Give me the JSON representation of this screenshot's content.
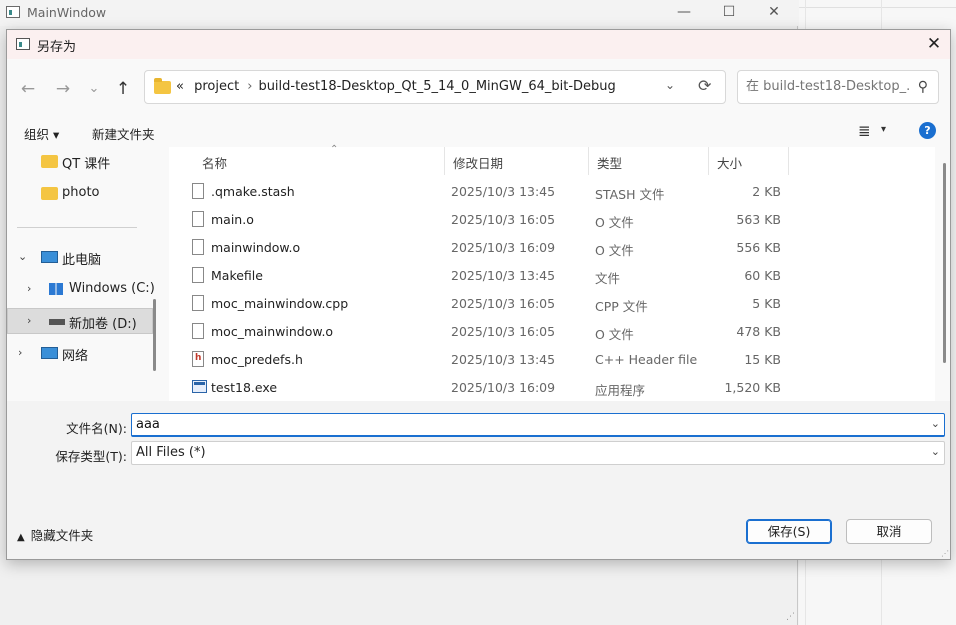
{
  "main_window": {
    "title": "MainWindow",
    "minimize": "—",
    "maximize": "☐",
    "close": "✕"
  },
  "dialog": {
    "title": "另存为",
    "close": "✕",
    "nav": {
      "back": "←",
      "forward": "→",
      "recent": "⌄",
      "up": "↑"
    },
    "address": {
      "overflow": "«",
      "path": [
        "project",
        "build-test18-Desktop_Qt_5_14_0_MinGW_64_bit-Debug"
      ],
      "separator": "›",
      "dropdown": "⌄",
      "refresh": "⟳"
    },
    "search": {
      "placeholder": "在 build-test18-Desktop_...",
      "icon": "search-icon"
    },
    "toolbar": {
      "organize": "组织 ▾",
      "new_folder": "新建文件夹",
      "view": "≣",
      "view_drop": "▾",
      "help": "?"
    },
    "nav_pane": {
      "items": [
        {
          "label": "QT 课件",
          "icon": "folder-icon"
        },
        {
          "label": "photo",
          "icon": "folder-icon"
        },
        {
          "label": "此电脑",
          "icon": "computer-icon",
          "chevron": "⌄"
        },
        {
          "label": "Windows (C:)",
          "icon": "windows-drive-icon",
          "chevron": "›"
        },
        {
          "label": "新加卷 (D:)",
          "icon": "drive-icon",
          "chevron": "›",
          "selected": true
        },
        {
          "label": "网络",
          "icon": "network-icon",
          "chevron": "›"
        }
      ]
    },
    "file_list": {
      "columns": {
        "name": "名称",
        "date": "修改日期",
        "type": "类型",
        "size": "大小"
      },
      "sort_arrow": "⌃",
      "rows": [
        {
          "name": ".qmake.stash",
          "date": "2025/10/3 13:45",
          "type": "STASH 文件",
          "size": "2 KB",
          "icon": "file-icon"
        },
        {
          "name": "main.o",
          "date": "2025/10/3 16:05",
          "type": "O 文件",
          "size": "563 KB",
          "icon": "file-icon"
        },
        {
          "name": "mainwindow.o",
          "date": "2025/10/3 16:09",
          "type": "O 文件",
          "size": "556 KB",
          "icon": "file-icon"
        },
        {
          "name": "Makefile",
          "date": "2025/10/3 13:45",
          "type": "文件",
          "size": "60 KB",
          "icon": "file-icon"
        },
        {
          "name": "moc_mainwindow.cpp",
          "date": "2025/10/3 16:05",
          "type": "CPP 文件",
          "size": "5 KB",
          "icon": "file-icon"
        },
        {
          "name": "moc_mainwindow.o",
          "date": "2025/10/3 16:05",
          "type": "O 文件",
          "size": "478 KB",
          "icon": "file-icon"
        },
        {
          "name": "moc_predefs.h",
          "date": "2025/10/3 13:45",
          "type": "C++ Header file",
          "size": "15 KB",
          "icon": "header-file-icon"
        },
        {
          "name": "test18.exe",
          "date": "2025/10/3 16:09",
          "type": "应用程序",
          "size": "1,520 KB",
          "icon": "exe-icon"
        }
      ]
    },
    "form": {
      "filename_label": "文件名(N):",
      "filename_value": "aaa",
      "filetype_label": "保存类型(T):",
      "filetype_value": "All Files  (*)",
      "chevron": "⌄"
    },
    "footer": {
      "hide_folders": "隐藏文件夹",
      "hide_arrow": "▲",
      "save": "保存(S)",
      "cancel": "取消"
    }
  }
}
